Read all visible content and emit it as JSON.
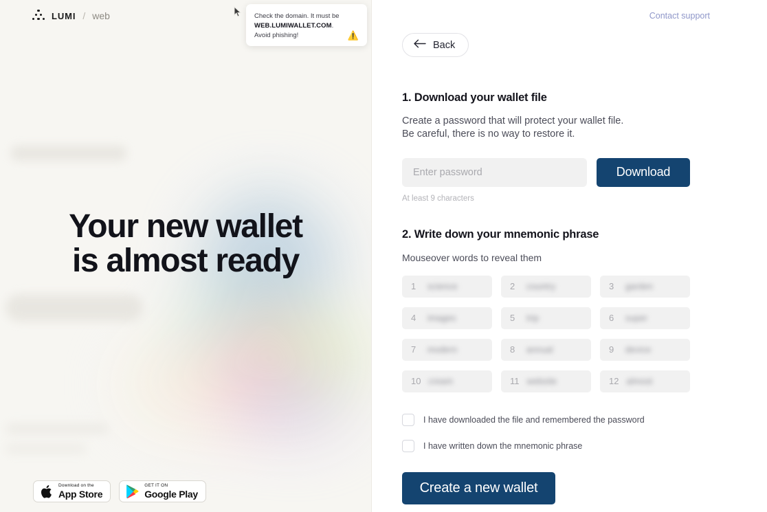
{
  "brand": {
    "mark_icon": "lumi-dots-logo",
    "name": "LUMI",
    "separator": "/",
    "sub": "web"
  },
  "left": {
    "headline_line1": "Your new wallet",
    "headline_line2": "is almost ready",
    "stores": [
      {
        "icon": "apple-icon",
        "top_label": "Download on the",
        "bottom_label": "App Store"
      },
      {
        "icon": "google-play-icon",
        "top_label": "GET IT ON",
        "bottom_label": "Google Play"
      }
    ]
  },
  "phishing_tip": {
    "text_before": "Check the domain. It must be ",
    "domain": "WEB.LUMIWALLET.COM",
    "text_after": ".",
    "line3": "Avoid phishing!",
    "warn_icon": "warning-triangle-icon"
  },
  "cursor": {
    "icon": "mouse-pointer-icon"
  },
  "right": {
    "contact_support": "Contact support",
    "back_label": "Back",
    "back_icon": "arrow-left-icon",
    "section1": {
      "title": "1. Download your wallet file",
      "desc_line1": "Create a password that will protect your wallet file.",
      "desc_line2": "Be careful, there is no way to restore it.",
      "password_value": "",
      "password_placeholder": "Enter password",
      "download_label": "Download",
      "hint": "At least 9 characters"
    },
    "section2": {
      "title": "2. Write down your mnemonic phrase",
      "hint": "Mouseover words to reveal them",
      "words": [
        {
          "num": "1",
          "word": "science"
        },
        {
          "num": "2",
          "word": "country"
        },
        {
          "num": "3",
          "word": "garden"
        },
        {
          "num": "4",
          "word": "images"
        },
        {
          "num": "5",
          "word": "trip"
        },
        {
          "num": "6",
          "word": "super"
        },
        {
          "num": "7",
          "word": "modern"
        },
        {
          "num": "8",
          "word": "annual"
        },
        {
          "num": "9",
          "word": "device"
        },
        {
          "num": "10",
          "word": "cream"
        },
        {
          "num": "11",
          "word": "website"
        },
        {
          "num": "12",
          "word": "almost"
        }
      ]
    },
    "checkboxes": [
      {
        "label": "I have downloaded the file and remembered the password",
        "checked": false
      },
      {
        "label": "I have written down the mnemonic phrase",
        "checked": false
      }
    ],
    "create_label": "Create a new wallet"
  },
  "colors": {
    "accent_dark_blue": "#144470",
    "panel_bg": "#f7f6f2",
    "field_bg": "#f1f1f1",
    "link_blue": "#8f97c9",
    "warn_yellow": "#f5c518"
  }
}
